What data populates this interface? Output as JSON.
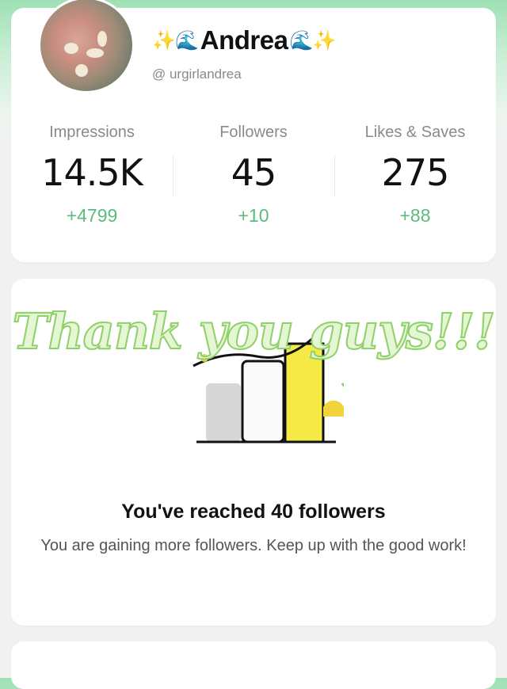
{
  "profile": {
    "name": "Andrea",
    "name_prefix_emoji": "✨🌊",
    "name_suffix_emoji": "🌊✨",
    "handle": "@ urgirlandrea"
  },
  "stats": [
    {
      "label": "Impressions",
      "value": "14.5K",
      "delta": "+4799"
    },
    {
      "label": "Followers",
      "value": "45",
      "delta": "+10"
    },
    {
      "label": "Likes & Saves",
      "value": "275",
      "delta": "+88"
    }
  ],
  "milestone": {
    "overlay_text": "Thank you guys!!!",
    "title": "You've reached 40 followers",
    "description": "You are gaining more followers. Keep up with the good work!"
  },
  "colors": {
    "accent_green": "#5bbb7a",
    "header_gradient": "#9fe0b4",
    "bar_yellow": "#f5ea45",
    "bar_gray": "#d6d6d6"
  },
  "icons": [
    "sparkle-icon",
    "wave-icon",
    "milestone-bar-chart-icon"
  ]
}
